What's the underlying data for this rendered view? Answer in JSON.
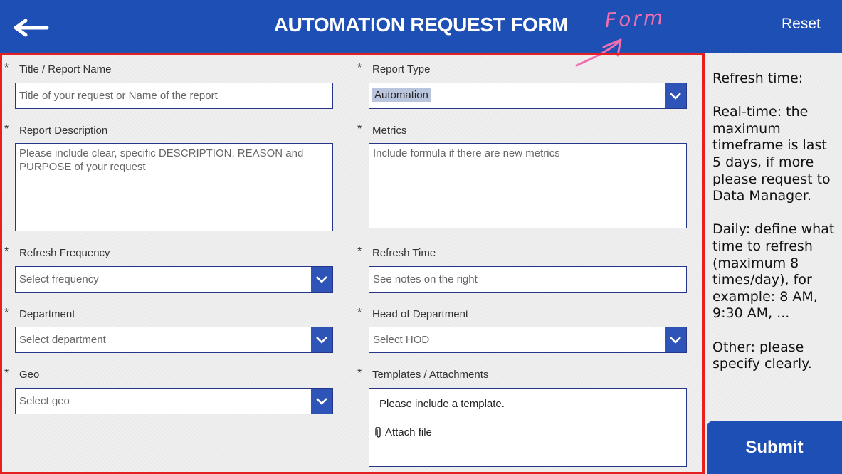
{
  "header": {
    "title": "AUTOMATION REQUEST FORM",
    "reset_label": "Reset",
    "annotation": "Form"
  },
  "form": {
    "required_marker": "*",
    "title_field": {
      "label": "Title / Report Name",
      "placeholder": "Title of your request or Name of the report"
    },
    "report_type": {
      "label": "Report Type",
      "value": "Automation"
    },
    "description": {
      "label": "Report Description",
      "placeholder": "Please include clear, specific DESCRIPTION, REASON and PURPOSE of your request"
    },
    "metrics": {
      "label": "Metrics",
      "placeholder": "Include formula if there are new metrics"
    },
    "refresh_frequency": {
      "label": "Refresh Frequency",
      "placeholder": "Select frequency"
    },
    "refresh_time": {
      "label": "Refresh Time",
      "placeholder": "See notes on the right"
    },
    "department": {
      "label": "Department",
      "placeholder": "Select department"
    },
    "head_of_department": {
      "label": "Head of Department",
      "placeholder": "Select HOD"
    },
    "geo": {
      "label": "Geo",
      "placeholder": "Select geo"
    },
    "attachments": {
      "label": "Templates / Attachments",
      "note": "Please include a template.",
      "attach_label": "Attach file"
    }
  },
  "notes": {
    "heading": "Refresh time:",
    "realtime": "Real-time: the maximum timeframe is last 5 days, if more please request to Data Manager.",
    "daily": "Daily: define what time to refresh (maximum 8 times/day), for example: 8 AM, 9:30 AM, ...",
    "other": "Other: please specify clearly."
  },
  "submit_label": "Submit",
  "colors": {
    "primary": "#1e4fb4",
    "frame": "#e42020",
    "annotation": "#f06fb0",
    "field_border": "#26348a"
  }
}
